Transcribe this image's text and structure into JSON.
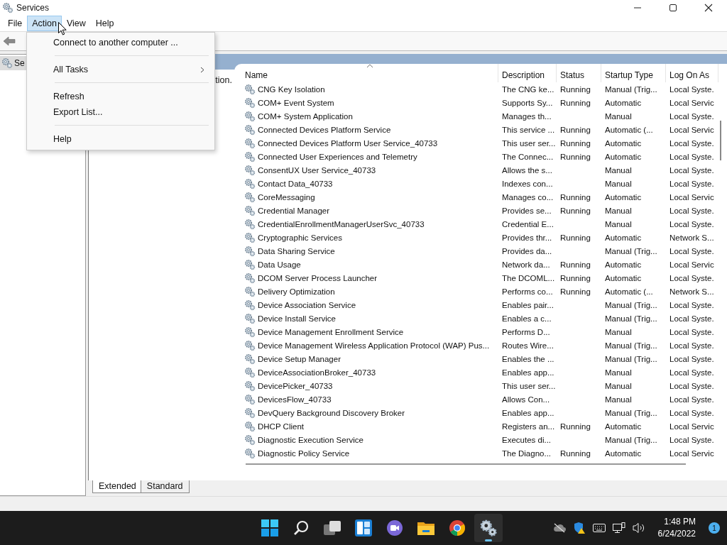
{
  "window": {
    "title": "Services"
  },
  "menu_bar": [
    {
      "label": "File",
      "selected": false
    },
    {
      "label": "Action",
      "selected": true
    },
    {
      "label": "View",
      "selected": false
    },
    {
      "label": "Help",
      "selected": false
    }
  ],
  "action_menu": [
    {
      "kind": "item",
      "label": "Connect to another computer ...",
      "submenu": false
    },
    {
      "kind": "separator"
    },
    {
      "kind": "item",
      "label": "All Tasks",
      "submenu": true
    },
    {
      "kind": "separator"
    },
    {
      "kind": "item",
      "label": "Refresh",
      "submenu": false
    },
    {
      "kind": "item",
      "label": "Export List...",
      "submenu": false
    },
    {
      "kind": "separator"
    },
    {
      "kind": "item",
      "label": "Help",
      "submenu": false
    }
  ],
  "tree": [
    {
      "label": "Se",
      "selected": true
    }
  ],
  "description_pane": {
    "text": "tion."
  },
  "table": {
    "columns": [
      {
        "label": "Name",
        "sorted": true
      },
      {
        "label": "Description",
        "sorted": false
      },
      {
        "label": "Status",
        "sorted": false
      },
      {
        "label": "Startup Type",
        "sorted": false
      },
      {
        "label": "Log On As",
        "sorted": false
      }
    ],
    "rows": [
      {
        "name": "CNG Key Isolation",
        "description": "The CNG ke...",
        "status": "Running",
        "startup_type": "Manual (Trig...",
        "log_on_as": "Local Syste."
      },
      {
        "name": "COM+ Event System",
        "description": "Supports Sy...",
        "status": "Running",
        "startup_type": "Automatic",
        "log_on_as": "Local Servic"
      },
      {
        "name": "COM+ System Application",
        "description": "Manages th...",
        "startup_type": "Manual",
        "log_on_as": "Local Syste."
      },
      {
        "name": "Connected Devices Platform Service",
        "description": "This service ...",
        "status": "Running",
        "startup_type": "Automatic (...",
        "log_on_as": "Local Servic"
      },
      {
        "name": "Connected Devices Platform User Service_40733",
        "description": "This user ser...",
        "status": "Running",
        "startup_type": "Automatic",
        "log_on_as": "Local Syste."
      },
      {
        "name": "Connected User Experiences and Telemetry",
        "description": "The Connec...",
        "status": "Running",
        "startup_type": "Automatic",
        "log_on_as": "Local Syste."
      },
      {
        "name": "ConsentUX User Service_40733",
        "description": "Allows the s...",
        "startup_type": "Manual",
        "log_on_as": "Local Syste."
      },
      {
        "name": "Contact Data_40733",
        "description": "Indexes con...",
        "startup_type": "Manual",
        "log_on_as": "Local Syste."
      },
      {
        "name": "CoreMessaging",
        "description": "Manages co...",
        "status": "Running",
        "startup_type": "Automatic",
        "log_on_as": "Local Servic"
      },
      {
        "name": "Credential Manager",
        "description": "Provides se...",
        "status": "Running",
        "startup_type": "Manual",
        "log_on_as": "Local Syste."
      },
      {
        "name": "CredentialEnrollmentManagerUserSvc_40733",
        "description": "Credential E...",
        "startup_type": "Manual",
        "log_on_as": "Local Syste."
      },
      {
        "name": "Cryptographic Services",
        "description": "Provides thr...",
        "status": "Running",
        "startup_type": "Automatic",
        "log_on_as": "Network S..."
      },
      {
        "name": "Data Sharing Service",
        "description": "Provides da...",
        "startup_type": "Manual (Trig...",
        "log_on_as": "Local Syste."
      },
      {
        "name": "Data Usage",
        "description": "Network da...",
        "status": "Running",
        "startup_type": "Automatic",
        "log_on_as": "Local Servic"
      },
      {
        "name": "DCOM Server Process Launcher",
        "description": "The DCOML...",
        "status": "Running",
        "startup_type": "Automatic",
        "log_on_as": "Local Syste."
      },
      {
        "name": "Delivery Optimization",
        "description": "Performs co...",
        "status": "Running",
        "startup_type": "Automatic (...",
        "log_on_as": "Network S..."
      },
      {
        "name": "Device Association Service",
        "description": "Enables pair...",
        "startup_type": "Manual (Trig...",
        "log_on_as": "Local Syste."
      },
      {
        "name": "Device Install Service",
        "description": "Enables a c...",
        "startup_type": "Manual (Trig...",
        "log_on_as": "Local Syste."
      },
      {
        "name": "Device Management Enrollment Service",
        "description": "Performs D...",
        "startup_type": "Manual",
        "log_on_as": "Local Syste."
      },
      {
        "name": "Device Management Wireless Application Protocol (WAP) Pus...",
        "description": "Routes Wire...",
        "startup_type": "Manual (Trig...",
        "log_on_as": "Local Syste."
      },
      {
        "name": "Device Setup Manager",
        "description": "Enables the ...",
        "startup_type": "Manual (Trig...",
        "log_on_as": "Local Syste."
      },
      {
        "name": "DeviceAssociationBroker_40733",
        "description": "Enables app...",
        "startup_type": "Manual",
        "log_on_as": "Local Syste."
      },
      {
        "name": "DevicePicker_40733",
        "description": "This user ser...",
        "startup_type": "Manual",
        "log_on_as": "Local Syste."
      },
      {
        "name": "DevicesFlow_40733",
        "description": "Allows Con...",
        "startup_type": "Manual",
        "log_on_as": "Local Syste."
      },
      {
        "name": "DevQuery Background Discovery Broker",
        "description": "Enables app...",
        "startup_type": "Manual (Trig...",
        "log_on_as": "Local Syste."
      },
      {
        "name": "DHCP Client",
        "description": "Registers an...",
        "status": "Running",
        "startup_type": "Automatic",
        "log_on_as": "Local Servic"
      },
      {
        "name": "Diagnostic Execution Service",
        "description": "Executes di...",
        "startup_type": "Manual (Trig...",
        "log_on_as": "Local Syste."
      },
      {
        "name": "Diagnostic Policy Service",
        "description": "The Diagno...",
        "status": "Running",
        "startup_type": "Automatic",
        "log_on_as": "Local Servic"
      }
    ]
  },
  "view_tabs": [
    {
      "label": "Extended",
      "selected": true
    },
    {
      "label": "Standard",
      "selected": false
    }
  ],
  "taskbar": {
    "apps": [
      {
        "kind": "start",
        "active": false
      },
      {
        "kind": "search",
        "active": false
      },
      {
        "kind": "task-view",
        "active": false
      },
      {
        "kind": "widgets",
        "active": false
      },
      {
        "kind": "chat",
        "active": false
      },
      {
        "kind": "explorer",
        "active": false
      },
      {
        "kind": "browser",
        "active": false
      },
      {
        "kind": "services",
        "active": true
      }
    ],
    "tray": [
      {
        "kind": "cloud-off"
      },
      {
        "kind": "shield-warning"
      },
      {
        "kind": "keyboard"
      },
      {
        "kind": "network"
      },
      {
        "kind": "volume"
      }
    ],
    "time": "1:48 PM",
    "date": "6/24/2022",
    "notifications": "1"
  }
}
